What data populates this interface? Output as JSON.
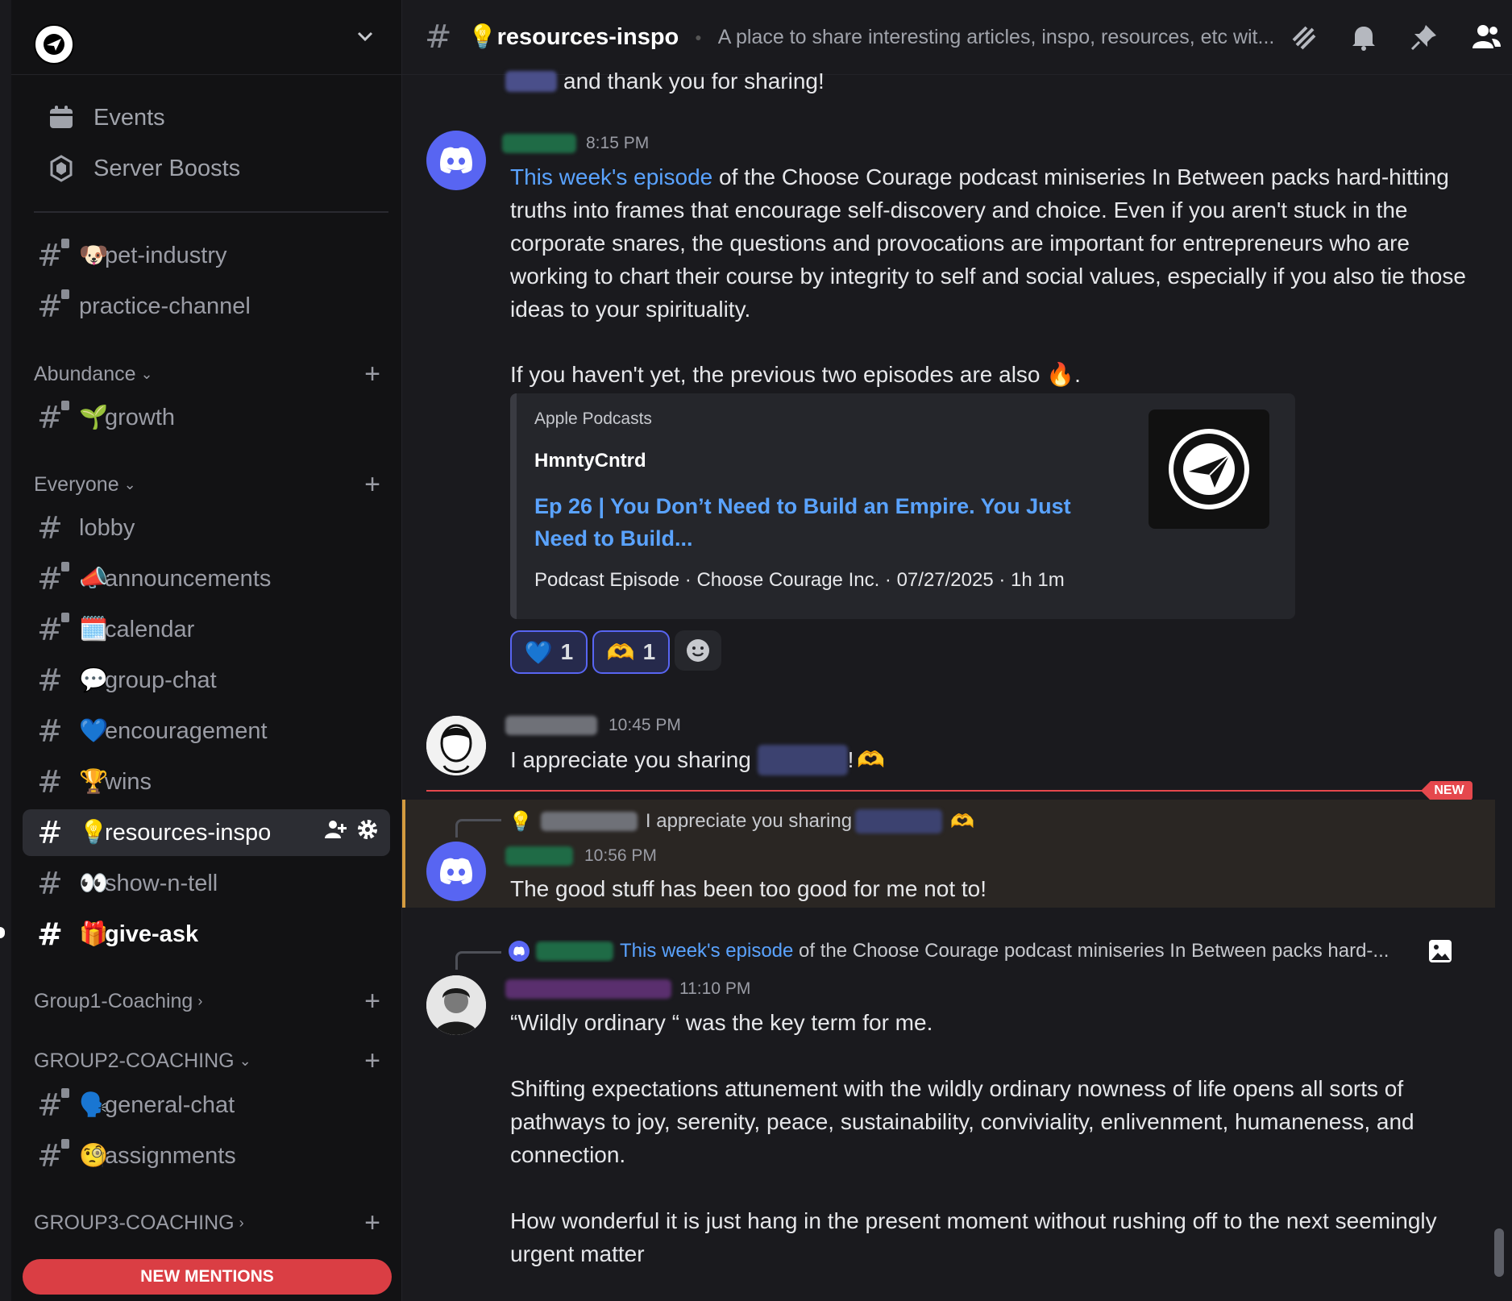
{
  "server": {
    "name_icon": "choose-courage-logo"
  },
  "sidebar": {
    "top_items": [
      {
        "label": "Events",
        "icon": "calendar-icon"
      },
      {
        "label": "Server Boosts",
        "icon": "boost-icon"
      }
    ],
    "channels_ungrouped": [
      {
        "emoji": "🐶",
        "label": "pet-industry"
      },
      {
        "emoji": "",
        "label": "practice-channel"
      }
    ],
    "categories": [
      {
        "label": "Abundance",
        "channels": [
          {
            "emoji": "🌱",
            "label": "growth"
          }
        ]
      },
      {
        "label": "Everyone",
        "channels": [
          {
            "emoji": "",
            "label": "lobby"
          },
          {
            "emoji": "📣",
            "label": "announcements"
          },
          {
            "emoji": "🗓️",
            "label": "calendar"
          },
          {
            "emoji": "💬",
            "label": "group-chat"
          },
          {
            "emoji": "💙",
            "label": "encouragement"
          },
          {
            "emoji": "🏆",
            "label": "wins"
          },
          {
            "emoji": "💡",
            "label": "resources-inspo"
          },
          {
            "emoji": "👀",
            "label": "show-n-tell"
          },
          {
            "emoji": "🎁",
            "label": "give-ask"
          }
        ]
      },
      {
        "label": "Group1-Coaching"
      },
      {
        "label": "GROUP2-COACHING",
        "channels": [
          {
            "emoji": "🗣️",
            "label": "general-chat"
          },
          {
            "emoji": "🧐",
            "label": "assignments"
          }
        ]
      },
      {
        "label": "GROUP3-COACHING"
      }
    ],
    "new_mentions": "NEW MENTIONS"
  },
  "header": {
    "channel_emoji": "💡",
    "channel_name": "resources-inspo",
    "topic": "A place to share interesting articles, inspo, resources, etc wit..."
  },
  "messages": {
    "prev_tail": "and thank you for sharing!",
    "m1": {
      "time": "8:15 PM",
      "link_text": "This week's episode",
      "text_after_link": " of the Choose Courage podcast miniseries In Between packs hard-hitting truths into frames that encourage self-discovery and choice. Even if you aren't stuck in the corporate snares, the questions and provocations are important for entrepreneurs who are working to chart their course by integrity to self and social values, especially if you also tie those ideas to your spirituality.",
      "text2": "If you haven't yet, the previous two episodes are also",
      "text2_emoji": "🔥",
      "embed": {
        "provider": "Apple Podcasts",
        "author": "HmntyCntrd",
        "title": "Ep 26 | You Don’t Need to Build an Empire. You Just Need to Build...",
        "footer": "Podcast Episode · Choose Courage Inc. · 07/27/2025 · 1h 1m"
      },
      "reactions": [
        {
          "emoji": "💙",
          "count": "1"
        },
        {
          "emoji": "🫶",
          "count": "1"
        }
      ]
    },
    "m2": {
      "time": "10:45 PM",
      "text_before": "I appreciate you sharing ",
      "text_after": "!",
      "emoji": "🫶"
    },
    "new_badge": "NEW",
    "m3": {
      "reply_text": "I appreciate you sharing",
      "reply_emoji": "🫶",
      "time": "10:56 PM",
      "text": "The good stuff has been too good for me not to!"
    },
    "m4": {
      "reply_link": "This week's episode",
      "reply_text": " of the Choose Courage podcast miniseries In Between packs hard-...",
      "time": "11:10 PM",
      "p1": "“Wildly ordinary “ was the key term for me.",
      "p2": "Shifting expectations attunement with the wildly ordinary nowness of life opens all sorts of pathways to joy, serenity, peace, sustainability, conviviality, enlivenment, humaneness, and connection.",
      "p3": "How wonderful it is just hang in the present moment without rushing off to the next seemingly urgent matter"
    }
  }
}
